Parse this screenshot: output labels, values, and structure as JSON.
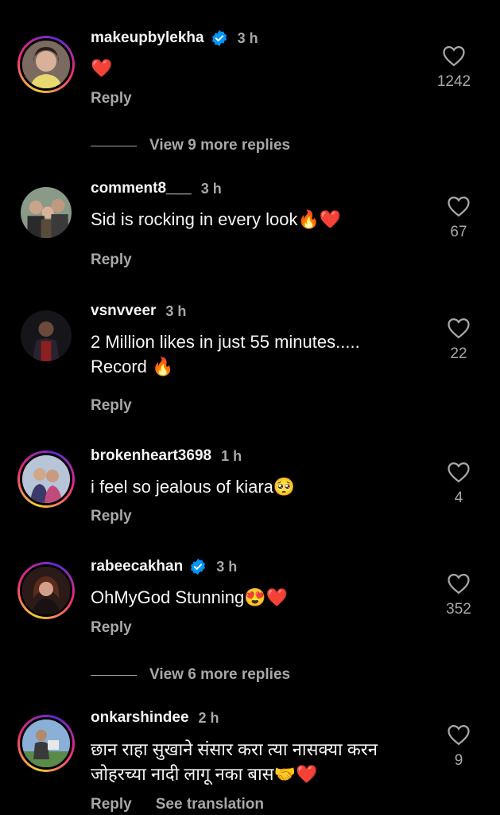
{
  "colors": {
    "background": "#000000",
    "text_primary": "#f5f5f5",
    "text_secondary": "#a8a8a8",
    "verified_blue": "#0095f6",
    "heart_red": "#e8312f"
  },
  "icons": {
    "like": "heart-outline-icon",
    "verified": "verified-badge-icon"
  },
  "comments": [
    {
      "username": "makeupbylekha",
      "verified": true,
      "time": "3 h",
      "text": "❤️",
      "reply": "Reply",
      "likes": "1242",
      "story_ring": true
    },
    {
      "username": "comment8___",
      "verified": false,
      "time": "3 h",
      "text": "Sid is rocking in every look🔥❤️",
      "reply": "Reply",
      "likes": "67",
      "story_ring": false
    },
    {
      "username": "vsnvveer",
      "verified": false,
      "time": "3 h",
      "text": "2 Million likes in just 55 minutes..... Record 🔥",
      "reply": "Reply",
      "likes": "22",
      "story_ring": false
    },
    {
      "username": "brokenheart3698",
      "verified": false,
      "time": "1 h",
      "text": "i feel so jealous of kiara🥺",
      "reply": "Reply",
      "likes": "4",
      "story_ring": true
    },
    {
      "username": "rabeecakhan",
      "verified": true,
      "time": "3 h",
      "text": "OhMyGod Stunning😍❤️",
      "reply": "Reply",
      "likes": "352",
      "story_ring": true
    },
    {
      "username": "onkarshindee",
      "verified": false,
      "time": "2 h",
      "text": "छान राहा सुखाने संसार करा त्या नासक्या करन जोहरच्या नादी लागू नका बास🤝❤️",
      "reply": "Reply",
      "see_translation": "See translation",
      "likes": "9",
      "story_ring": true
    }
  ],
  "view_more": [
    {
      "label": "View 9 more replies"
    },
    {
      "label": "View 6 more replies"
    }
  ]
}
